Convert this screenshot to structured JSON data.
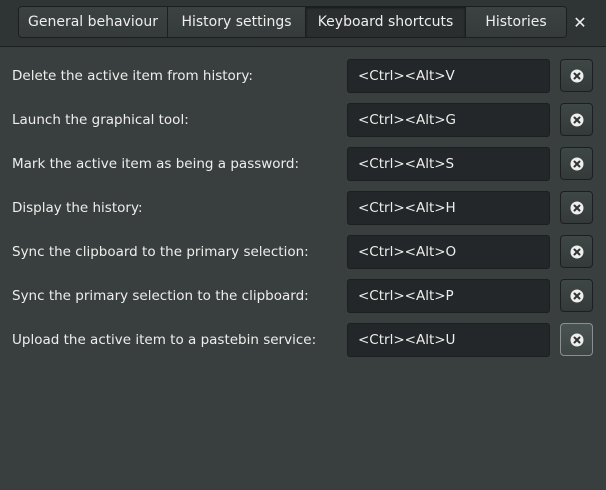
{
  "tabs": [
    {
      "label": "General behaviour",
      "active": false
    },
    {
      "label": "History settings",
      "active": false
    },
    {
      "label": "Keyboard shortcuts",
      "active": true
    },
    {
      "label": "Histories",
      "active": false
    }
  ],
  "window": {
    "close_label": "✕"
  },
  "shortcuts": [
    {
      "label": "Delete the active item from history:",
      "value": "<Ctrl><Alt>V"
    },
    {
      "label": "Launch the graphical tool:",
      "value": "<Ctrl><Alt>G"
    },
    {
      "label": "Mark the active item as being a password:",
      "value": "<Ctrl><Alt>S"
    },
    {
      "label": "Display the history:",
      "value": "<Ctrl><Alt>H"
    },
    {
      "label": "Sync the clipboard to the primary selection:",
      "value": "<Ctrl><Alt>O"
    },
    {
      "label": "Sync the primary selection to the clipboard:",
      "value": "<Ctrl><Alt>P"
    },
    {
      "label": "Upload the active item to a pastebin service:",
      "value": "<Ctrl><Alt>U"
    }
  ],
  "icons": {
    "clear": "clear-circle-x-icon",
    "close": "close-icon"
  },
  "colors": {
    "background": "#393f3f",
    "header": "#2f3434",
    "entry": "#232729",
    "text": "#eeeeec"
  }
}
